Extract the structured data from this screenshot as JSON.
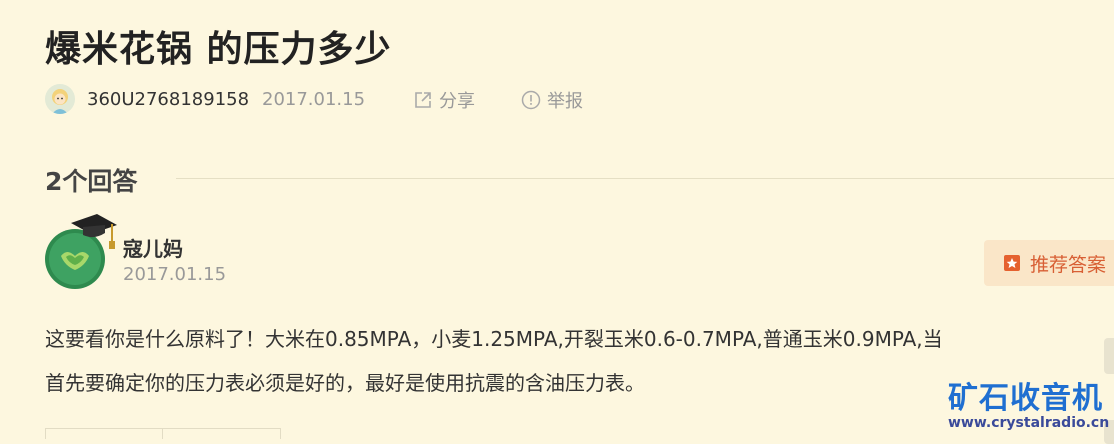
{
  "question": {
    "title": "爆米花锅 的压力多少"
  },
  "meta": {
    "username": "360U2768189158",
    "date": "2017.01.15",
    "share_label": "分享",
    "report_label": "举报"
  },
  "answers": {
    "count_label": "2个回答",
    "items": [
      {
        "username": "寇儿妈",
        "date": "2017.01.15",
        "recommend_label": "推荐答案",
        "lines": [
          "这要看你是什么原料了！大米在0.85MPA，小麦1.25MPA,开裂玉米0.6-0.7MPA,普通玉米0.9MPA,当",
          "首先要确定你的压力表必须是好的，最好是使用抗震的含油压力表。"
        ]
      }
    ]
  },
  "watermark": {
    "text": "矿石收音机",
    "url": "www.crystalradio.cn"
  },
  "icons": {
    "meta_avatar": "cartoon-avatar-icon",
    "share": "share-icon",
    "report": "info-circle-icon",
    "answer_avatar": "graduate-avatar-icon",
    "recommend": "bookmark-icon"
  },
  "colors": {
    "background": "#fdf7df",
    "recommend_bg": "#fae6c8",
    "recommend_text": "#d85f34",
    "watermark_blue": "#1f6fd1"
  }
}
